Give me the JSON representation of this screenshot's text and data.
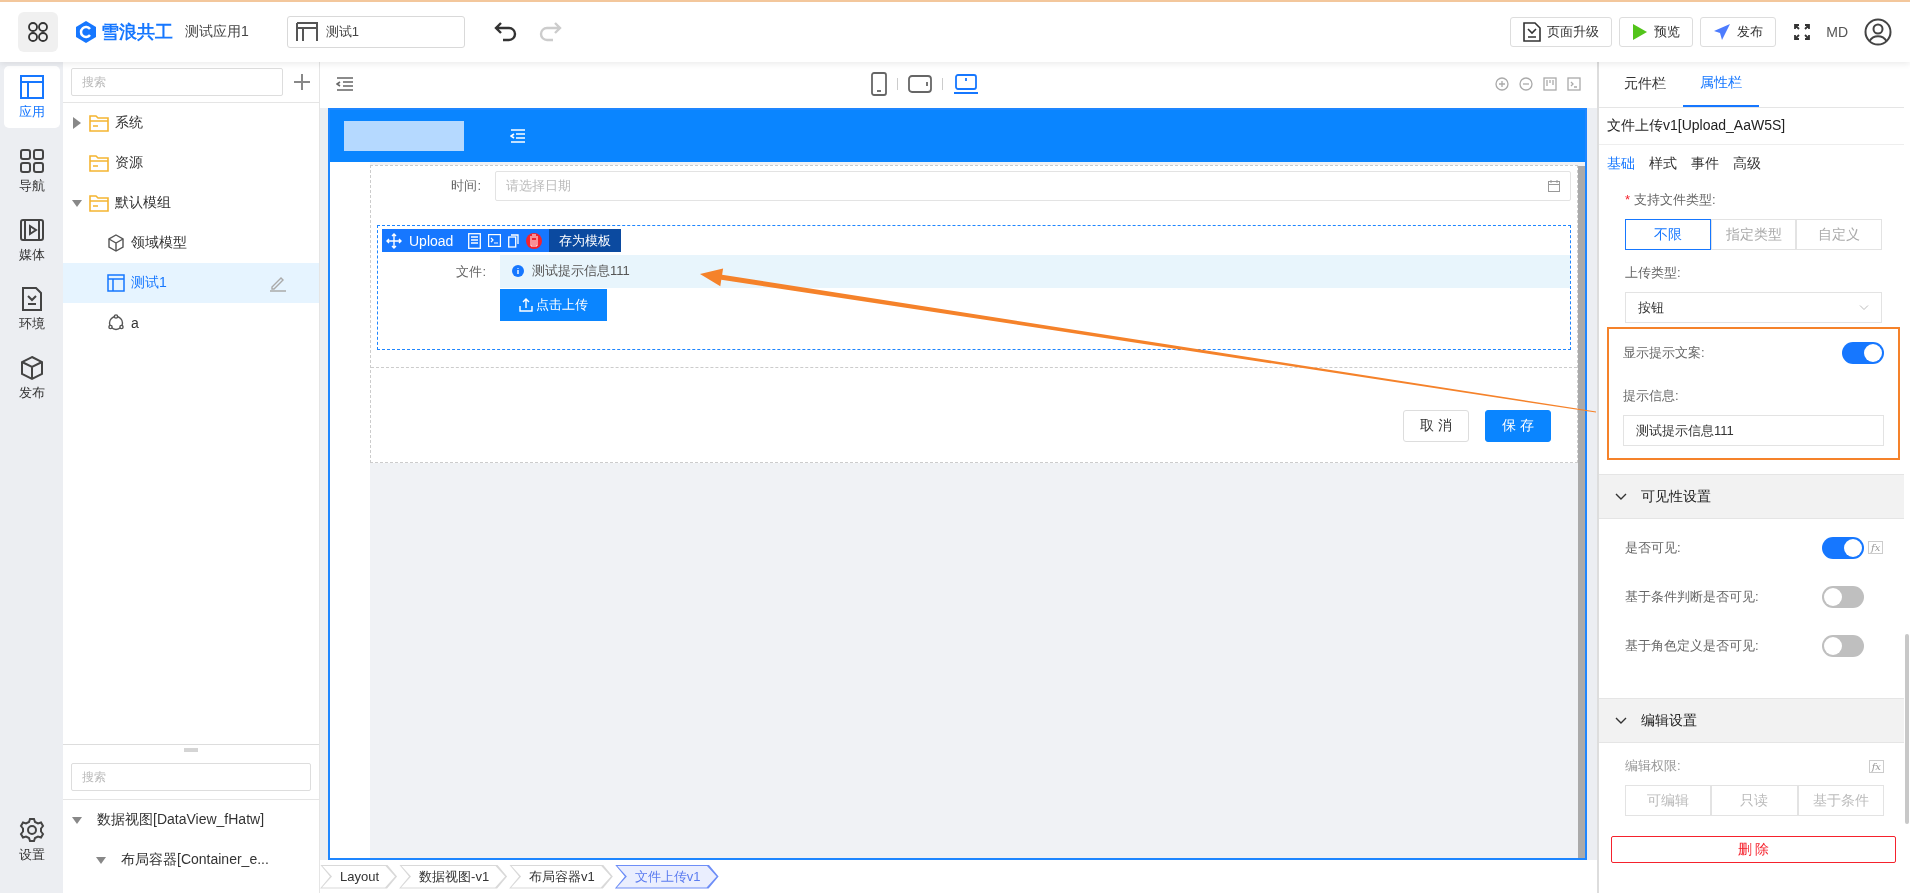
{
  "app_bar": {
    "logo_text": "雪浪共工",
    "app_name": "测试应用1",
    "page_selector": "测试1",
    "history": [
      {
        "kind": "undo",
        "disabled": false
      },
      {
        "kind": "redo",
        "disabled": true
      }
    ],
    "buttons": [
      {
        "kind": "upgrade",
        "label": "页面升级"
      },
      {
        "kind": "preview",
        "label": "预览"
      },
      {
        "kind": "publish",
        "label": "发布"
      }
    ],
    "user_initials": "MD"
  },
  "rail": {
    "items": [
      {
        "kind": "app",
        "label": "应用",
        "selected": true
      },
      {
        "kind": "nav",
        "label": "导航",
        "selected": false
      },
      {
        "kind": "media",
        "label": "媒体",
        "selected": false
      },
      {
        "kind": "env",
        "label": "环境",
        "selected": false
      },
      {
        "kind": "publish",
        "label": "发布",
        "selected": false
      }
    ],
    "bottom_items": [
      {
        "kind": "settings",
        "label": "设置",
        "selected": false
      }
    ]
  },
  "tree": {
    "search_placeholder": "搜索",
    "items": [
      {
        "kind": "folder",
        "label": "系统",
        "expanded": false,
        "selected": false
      },
      {
        "kind": "folder",
        "label": "资源",
        "selected": false
      },
      {
        "kind": "folder",
        "label": "默认模组",
        "expanded": true,
        "selected": false,
        "children": [
          {
            "kind": "model",
            "label": "领域模型",
            "selected": false
          },
          {
            "kind": "page",
            "label": "测试1",
            "selected": true
          },
          {
            "kind": "flow",
            "label": "a",
            "selected": false
          }
        ]
      }
    ]
  },
  "outline": {
    "search_placeholder": "搜索",
    "items": [
      {
        "label": "数据视图[DataView_fHatw]",
        "expanded": true,
        "children": [
          {
            "label": "布局容器[Container_e...",
            "expanded": true
          }
        ]
      }
    ]
  },
  "canvas": {
    "devices": [
      {
        "kind": "phone",
        "selected": false
      },
      {
        "kind": "tablet",
        "selected": false
      },
      {
        "kind": "desktop",
        "selected": true
      }
    ],
    "form": {
      "date_field": {
        "label": "时间:",
        "placeholder": "请选择日期"
      },
      "selected_component": {
        "name": "Upload",
        "action_label": "存为模板"
      },
      "upload": {
        "label": "文件:",
        "tip": "测试提示信息111",
        "button": "点击上传"
      },
      "actions": [
        {
          "kind": "default",
          "label": "取 消"
        },
        {
          "kind": "primary",
          "label": "保 存"
        }
      ]
    }
  },
  "breadcrumbs": [
    {
      "label": "Layout",
      "selected": false
    },
    {
      "label": "数据视图-v1",
      "selected": false
    },
    {
      "label": "布局容器v1",
      "selected": false
    },
    {
      "label": "文件上传v1",
      "selected": true
    }
  ],
  "properties": {
    "tabs": [
      {
        "label": "元件栏",
        "selected": false
      },
      {
        "label": "属性栏",
        "selected": true
      }
    ],
    "component_title": "文件上传v1[Upload_AaW5S]",
    "sub_tabs": [
      {
        "label": "基础",
        "selected": true
      },
      {
        "label": "样式",
        "selected": false
      },
      {
        "label": "事件",
        "selected": false
      },
      {
        "label": "高级",
        "selected": false
      }
    ],
    "file_type": {
      "label": "支持文件类型:",
      "required_mark": "*",
      "options": [
        {
          "label": "不限",
          "selected": true
        },
        {
          "label": "指定类型",
          "selected": false
        },
        {
          "label": "自定义",
          "selected": false
        }
      ]
    },
    "upload_type": {
      "label": "上传类型:",
      "value": "按钮"
    },
    "show_tip": {
      "label": "显示提示文案:",
      "on": true
    },
    "tip_info": {
      "label": "提示信息:",
      "value": "测试提示信息111"
    },
    "sections": [
      {
        "kind": "toggles",
        "title": "可见性设置",
        "expanded": true,
        "rows": [
          {
            "label": "是否可见:",
            "on": true,
            "formula": "fx"
          },
          {
            "label": "基于条件判断是否可见:",
            "on": false
          },
          {
            "label": "基于角色定义是否可见:",
            "on": false
          }
        ]
      },
      {
        "kind": "segmented",
        "title": "编辑设置",
        "expanded": true,
        "permission": {
          "label": "编辑权限:",
          "formula": "fx",
          "disabled": true,
          "options": [
            {
              "label": "可编辑",
              "selected": false
            },
            {
              "label": "只读",
              "selected": false
            },
            {
              "label": "基于条件",
              "selected": false
            }
          ]
        }
      }
    ],
    "delete_button": "删 除"
  }
}
